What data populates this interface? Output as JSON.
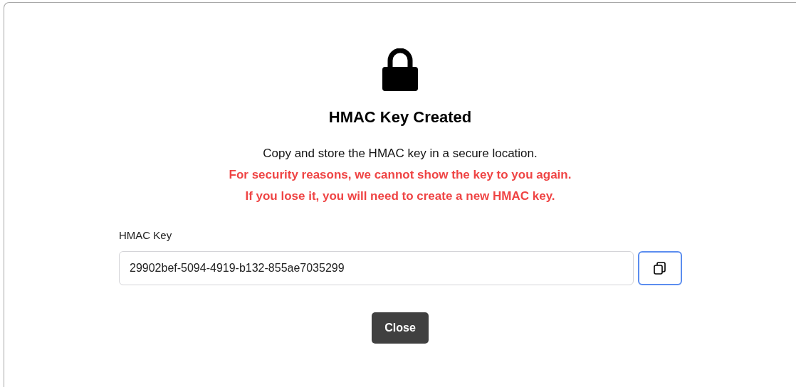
{
  "dialog": {
    "title": "HMAC Key Created",
    "message": "Copy and store the HMAC key in a secure location.",
    "warnings": [
      "For security reasons, we cannot show the key to you again.",
      "If you lose it, you will need to create a new HMAC key."
    ],
    "field": {
      "label": "HMAC Key",
      "value": "29902bef-5094-4919-b132-855ae7035299"
    },
    "buttons": [
      "Close"
    ]
  }
}
